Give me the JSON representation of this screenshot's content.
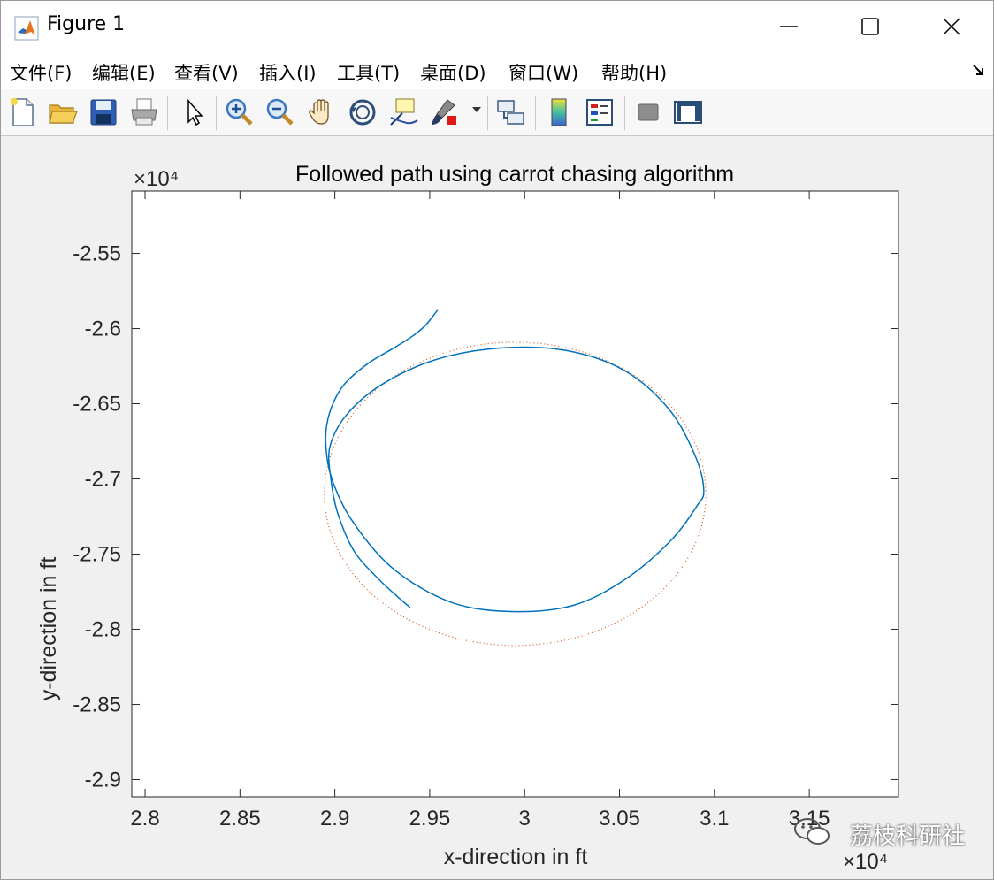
{
  "window": {
    "title": "Figure 1"
  },
  "menu": {
    "items": [
      "文件(F)",
      "编辑(E)",
      "查看(V)",
      "插入(I)",
      "工具(T)",
      "桌面(D)",
      "窗口(W)",
      "帮助(H)"
    ]
  },
  "toolbar": {
    "buttons": [
      "new-figure",
      "open",
      "save",
      "print",
      "select",
      "zoom-in",
      "zoom-out",
      "pan",
      "rotate-3d",
      "data-cursor",
      "brush",
      "link-plot",
      "colorbar",
      "legend",
      "hide-plot-tools",
      "show-plot-tools"
    ]
  },
  "watermark": "荔枝科研社",
  "chart_data": {
    "type": "line",
    "title": "Followed path using carrot chasing algorithm",
    "xlabel": "x-direction in ft",
    "ylabel": "y-direction in ft",
    "x_exponent_label": "×10⁴",
    "y_exponent_label": "×10⁴",
    "xlim": [
      2.793,
      3.197
    ],
    "ylim": [
      -2.9115,
      -2.5085
    ],
    "xticks": [
      2.8,
      2.85,
      2.9,
      2.95,
      3.0,
      3.05,
      3.1,
      3.15
    ],
    "xtick_labels": [
      "2.8",
      "2.85",
      "2.9",
      "2.95",
      "3",
      "3.05",
      "3.1",
      "3.15"
    ],
    "yticks": [
      -2.55,
      -2.6,
      -2.65,
      -2.7,
      -2.75,
      -2.8,
      -2.85,
      -2.9
    ],
    "ytick_labels": [
      "-2.55",
      "-2.6",
      "-2.65",
      "-2.7",
      "-2.75",
      "-2.8",
      "-2.85",
      "-2.9"
    ],
    "grid": false,
    "series": [
      {
        "role": "desired circular path",
        "style": "dotted",
        "color": "#d95319",
        "circle": {
          "center_x": 2.995,
          "center_y": -2.7099,
          "radius_x": 0.1005,
          "radius_y": 0.1009
        }
      },
      {
        "role": "followed path",
        "style": "solid",
        "color": "#0072bd",
        "x": [
          2.9544,
          2.9508,
          2.9472,
          2.9412,
          2.9316,
          2.9172,
          2.9043,
          2.8972,
          2.8952,
          2.8981,
          2.9089,
          2.9306,
          2.9618,
          2.995,
          3.0262,
          3.053,
          3.0765,
          3.0907,
          3.0944,
          3.0898,
          3.076,
          3.0526,
          3.0219,
          2.9872,
          2.9534,
          2.9252,
          2.9063,
          2.8974,
          2.898,
          2.9016,
          2.9103,
          2.9244,
          2.9397
        ],
        "y": [
          -2.5872,
          -2.5932,
          -2.5986,
          -2.6048,
          -2.6125,
          -2.6235,
          -2.6381,
          -2.6562,
          -2.6745,
          -2.6986,
          -2.7274,
          -2.7596,
          -2.7823,
          -2.7883,
          -2.7839,
          -2.7668,
          -2.7417,
          -2.7182,
          -2.7074,
          -2.6844,
          -2.6535,
          -2.6279,
          -2.6146,
          -2.6129,
          -2.6206,
          -2.6369,
          -2.6572,
          -2.6787,
          -2.7006,
          -2.7232,
          -2.7483,
          -2.7683,
          -2.7857
        ]
      }
    ]
  }
}
